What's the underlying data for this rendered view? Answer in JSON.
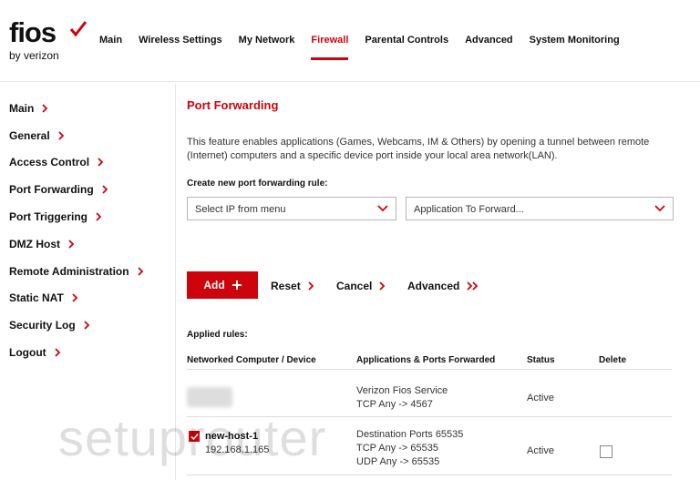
{
  "brand": {
    "name": "fios",
    "byline": "by verizon",
    "accent": "#cd040b"
  },
  "topnav": [
    {
      "label": "Main",
      "active": false
    },
    {
      "label": "Wireless Settings",
      "active": false
    },
    {
      "label": "My Network",
      "active": false
    },
    {
      "label": "Firewall",
      "active": true
    },
    {
      "label": "Parental Controls",
      "active": false
    },
    {
      "label": "Advanced",
      "active": false
    },
    {
      "label": "System Monitoring",
      "active": false
    }
  ],
  "sidebar": [
    {
      "label": "Main"
    },
    {
      "label": "General"
    },
    {
      "label": "Access Control"
    },
    {
      "label": "Port Forwarding"
    },
    {
      "label": "Port Triggering"
    },
    {
      "label": "DMZ Host"
    },
    {
      "label": "Remote Administration"
    },
    {
      "label": "Static NAT"
    },
    {
      "label": "Security Log"
    },
    {
      "label": "Logout"
    }
  ],
  "page": {
    "title": "Port Forwarding",
    "description": "This feature enables applications (Games, Webcams, IM & Others) by opening a tunnel between remote (Internet) computers and a specific device port inside your local area network(LAN).",
    "create_label": "Create new port forwarding rule:",
    "ip_select": "Select IP from menu",
    "app_select": "Application To Forward...",
    "buttons": {
      "add": "Add",
      "reset": "Reset",
      "cancel": "Cancel",
      "advanced": "Advanced"
    },
    "applied_label": "Applied rules:",
    "columns": [
      "Networked Computer / Device",
      "Applications & Ports Forwarded",
      "Status",
      "Delete"
    ],
    "rows": [
      {
        "device": "",
        "ip": "",
        "apps": [
          "Verizon Fios Service",
          "TCP Any -> 4567"
        ],
        "status": "Active",
        "deletable": false
      },
      {
        "device": "new-host-1",
        "ip": "192.168.1.165",
        "apps": [
          "Destination Ports 65535",
          "TCP Any -> 65535",
          "UDP Any -> 65535"
        ],
        "status": "Active",
        "deletable": true
      }
    ]
  },
  "watermark": "setuprouter"
}
